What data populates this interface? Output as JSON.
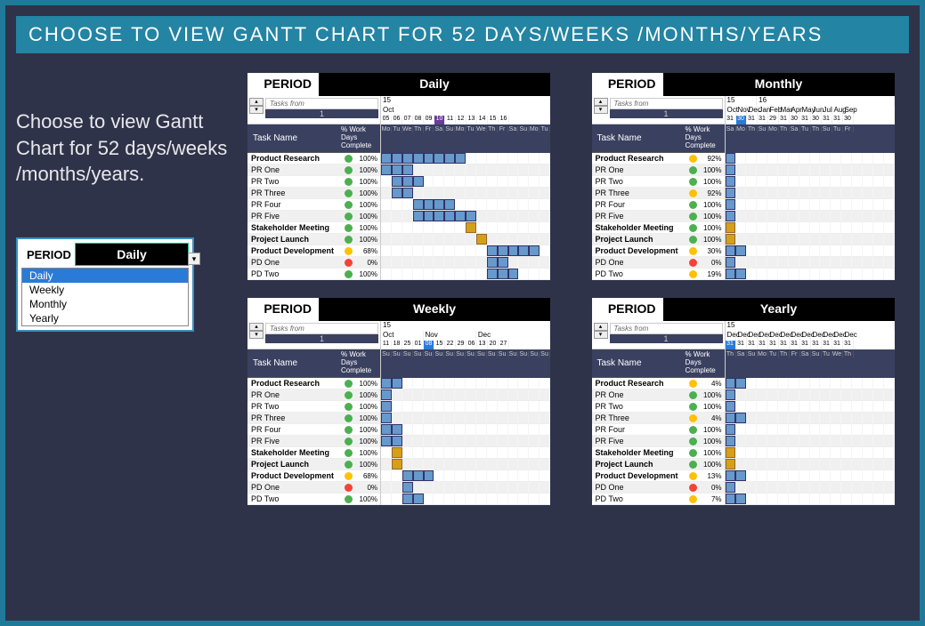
{
  "title": "CHOOSE TO VIEW GANTT CHART FOR 52 DAYS/WEEKS /MONTHS/YEARS",
  "description": "Choose to view Gantt Chart for 52 days/weeks /months/years.",
  "dropdown": {
    "period_label": "PERIOD",
    "selected": "Daily",
    "options": [
      "Daily",
      "Weekly",
      "Monthly",
      "Yearly"
    ]
  },
  "common": {
    "period_label": "PERIOD",
    "tasks_from_label": "Tasks from",
    "tasks_from_value": "1",
    "task_name_header": "Task Name",
    "work_days_header": "% Work Days Complete"
  },
  "tasks_daily": [
    {
      "name": "Product Research",
      "bold": true,
      "status": "green",
      "pct": "100%",
      "bar": [
        0,
        8
      ]
    },
    {
      "name": "PR One",
      "bold": false,
      "status": "green",
      "pct": "100%",
      "bar": [
        0,
        3
      ]
    },
    {
      "name": "PR Two",
      "bold": false,
      "status": "green",
      "pct": "100%",
      "bar": [
        1,
        4
      ]
    },
    {
      "name": "PR Three",
      "bold": false,
      "status": "green",
      "pct": "100%",
      "bar": [
        1,
        3
      ]
    },
    {
      "name": "PR Four",
      "bold": false,
      "status": "green",
      "pct": "100%",
      "bar": [
        3,
        7
      ]
    },
    {
      "name": "PR Five",
      "bold": false,
      "status": "green",
      "pct": "100%",
      "bar": [
        3,
        9
      ]
    },
    {
      "name": "Stakeholder Meeting",
      "bold": true,
      "status": "green",
      "pct": "100%",
      "obar": [
        8,
        9
      ]
    },
    {
      "name": "Project Launch",
      "bold": true,
      "status": "green",
      "pct": "100%",
      "obar": [
        9,
        10
      ]
    },
    {
      "name": "Product Development",
      "bold": true,
      "status": "yellow",
      "pct": "68%",
      "bar": [
        10,
        15
      ]
    },
    {
      "name": "PD One",
      "bold": false,
      "status": "red",
      "pct": "0%",
      "bar": [
        10,
        12
      ]
    },
    {
      "name": "PD Two",
      "bold": false,
      "status": "green",
      "pct": "100%",
      "bar": [
        10,
        13
      ]
    }
  ],
  "tasks_monthly": [
    {
      "name": "Product Research",
      "bold": true,
      "status": "yellow",
      "pct": "92%",
      "bar": [
        0,
        1
      ]
    },
    {
      "name": "PR One",
      "bold": false,
      "status": "green",
      "pct": "100%",
      "bar": [
        0,
        1
      ]
    },
    {
      "name": "PR Two",
      "bold": false,
      "status": "green",
      "pct": "100%",
      "bar": [
        0,
        1
      ]
    },
    {
      "name": "PR Three",
      "bold": false,
      "status": "yellow",
      "pct": "92%",
      "bar": [
        0,
        1
      ]
    },
    {
      "name": "PR Four",
      "bold": false,
      "status": "green",
      "pct": "100%",
      "bar": [
        0,
        1
      ]
    },
    {
      "name": "PR Five",
      "bold": false,
      "status": "green",
      "pct": "100%",
      "bar": [
        0,
        1
      ]
    },
    {
      "name": "Stakeholder Meeting",
      "bold": true,
      "status": "green",
      "pct": "100%",
      "obar": [
        0,
        1
      ]
    },
    {
      "name": "Project Launch",
      "bold": true,
      "status": "green",
      "pct": "100%",
      "obar": [
        0,
        1
      ]
    },
    {
      "name": "Product Development",
      "bold": true,
      "status": "yellow",
      "pct": "30%",
      "bar": [
        0,
        2
      ]
    },
    {
      "name": "PD One",
      "bold": false,
      "status": "red",
      "pct": "0%",
      "bar": [
        0,
        1
      ]
    },
    {
      "name": "PD Two",
      "bold": false,
      "status": "yellow",
      "pct": "19%",
      "bar": [
        0,
        2
      ]
    }
  ],
  "tasks_weekly": [
    {
      "name": "Product Research",
      "bold": true,
      "status": "green",
      "pct": "100%",
      "bar": [
        0,
        2
      ]
    },
    {
      "name": "PR One",
      "bold": false,
      "status": "green",
      "pct": "100%",
      "bar": [
        0,
        1
      ]
    },
    {
      "name": "PR Two",
      "bold": false,
      "status": "green",
      "pct": "100%",
      "bar": [
        0,
        1
      ]
    },
    {
      "name": "PR Three",
      "bold": false,
      "status": "green",
      "pct": "100%",
      "bar": [
        0,
        1
      ]
    },
    {
      "name": "PR Four",
      "bold": false,
      "status": "green",
      "pct": "100%",
      "bar": [
        0,
        2
      ]
    },
    {
      "name": "PR Five",
      "bold": false,
      "status": "green",
      "pct": "100%",
      "bar": [
        0,
        2
      ]
    },
    {
      "name": "Stakeholder Meeting",
      "bold": true,
      "status": "green",
      "pct": "100%",
      "obar": [
        1,
        2
      ]
    },
    {
      "name": "Project Launch",
      "bold": true,
      "status": "green",
      "pct": "100%",
      "obar": [
        1,
        2
      ]
    },
    {
      "name": "Product Development",
      "bold": true,
      "status": "yellow",
      "pct": "68%",
      "bar": [
        2,
        5
      ]
    },
    {
      "name": "PD One",
      "bold": false,
      "status": "red",
      "pct": "0%",
      "bar": [
        2,
        3
      ]
    },
    {
      "name": "PD Two",
      "bold": false,
      "status": "green",
      "pct": "100%",
      "bar": [
        2,
        4
      ]
    }
  ],
  "tasks_yearly": [
    {
      "name": "Product Research",
      "bold": true,
      "status": "yellow",
      "pct": "4%",
      "bar": [
        0,
        2
      ]
    },
    {
      "name": "PR One",
      "bold": false,
      "status": "green",
      "pct": "100%",
      "bar": [
        0,
        1
      ]
    },
    {
      "name": "PR Two",
      "bold": false,
      "status": "green",
      "pct": "100%",
      "bar": [
        0,
        1
      ]
    },
    {
      "name": "PR Three",
      "bold": false,
      "status": "yellow",
      "pct": "4%",
      "bar": [
        0,
        2
      ]
    },
    {
      "name": "PR Four",
      "bold": false,
      "status": "green",
      "pct": "100%",
      "bar": [
        0,
        1
      ]
    },
    {
      "name": "PR Five",
      "bold": false,
      "status": "green",
      "pct": "100%",
      "bar": [
        0,
        1
      ]
    },
    {
      "name": "Stakeholder Meeting",
      "bold": true,
      "status": "green",
      "pct": "100%",
      "obar": [
        0,
        1
      ]
    },
    {
      "name": "Project Launch",
      "bold": true,
      "status": "green",
      "pct": "100%",
      "obar": [
        0,
        1
      ]
    },
    {
      "name": "Product Development",
      "bold": true,
      "status": "yellow",
      "pct": "13%",
      "bar": [
        0,
        2
      ]
    },
    {
      "name": "PD One",
      "bold": false,
      "status": "red",
      "pct": "0%",
      "bar": [
        0,
        1
      ]
    },
    {
      "name": "PD Two",
      "bold": false,
      "status": "yellow",
      "pct": "7%",
      "bar": [
        0,
        2
      ]
    }
  ],
  "panels": [
    {
      "id": "daily",
      "value": "Daily",
      "tasks_key": "tasks_daily",
      "year_row": [
        {
          "label": "15",
          "span": 16
        }
      ],
      "month_row": [
        {
          "label": "Oct",
          "span": 16
        }
      ],
      "date_row": [
        "Mo",
        "Tu",
        "We",
        "Th",
        "Fr",
        "Sa",
        "Su",
        "Mo",
        "Tu",
        "We",
        "Th",
        "Fr",
        "Sa",
        "Su",
        "Mo",
        "Tu"
      ],
      "num_row": [
        "05",
        "06",
        "07",
        "08",
        "09",
        "10",
        "11",
        "12",
        "13",
        "14",
        "15",
        "16"
      ],
      "hl_idx": 5,
      "hl_style": "hl"
    },
    {
      "id": "monthly",
      "value": "Monthly",
      "tasks_key": "tasks_monthly",
      "year_row": [
        {
          "label": "15",
          "span": 3
        },
        {
          "label": "16",
          "span": 13
        }
      ],
      "month_row": [
        {
          "label": "Oct",
          "span": 1
        },
        {
          "label": "Nov",
          "span": 1
        },
        {
          "label": "Dec",
          "span": 1
        },
        {
          "label": "Jan",
          "span": 1
        },
        {
          "label": "Feb",
          "span": 1
        },
        {
          "label": "Mar",
          "span": 1
        },
        {
          "label": "Apr",
          "span": 1
        },
        {
          "label": "May",
          "span": 1
        },
        {
          "label": "Jun",
          "span": 1
        },
        {
          "label": "Jul",
          "span": 1
        },
        {
          "label": "Aug",
          "span": 1
        },
        {
          "label": "Sep",
          "span": 1
        }
      ],
      "date_row": [
        "Sa",
        "Mo",
        "Th",
        "Su",
        "Mo",
        "Th",
        "Sa",
        "Tu",
        "Th",
        "Su",
        "Tu",
        "Fr"
      ],
      "num_row": [
        "31",
        "30",
        "31",
        "31",
        "29",
        "31",
        "30",
        "31",
        "30",
        "31",
        "31",
        "30"
      ],
      "hl_idx": 1,
      "hl_style": "hl2"
    },
    {
      "id": "weekly",
      "value": "Weekly",
      "tasks_key": "tasks_weekly",
      "year_row": [
        {
          "label": "15",
          "span": 16
        }
      ],
      "month_row": [
        {
          "label": "Oct",
          "span": 4
        },
        {
          "label": "Nov",
          "span": 5
        },
        {
          "label": "Dec",
          "span": 7
        }
      ],
      "date_row": [
        "Su",
        "Su",
        "Su",
        "Su",
        "Su",
        "Su",
        "Su",
        "Su",
        "Su",
        "Su",
        "Su",
        "Su",
        "Su",
        "Su",
        "Su",
        "Su"
      ],
      "num_row": [
        "11",
        "18",
        "25",
        "01",
        "08",
        "15",
        "22",
        "29",
        "06",
        "13",
        "20",
        "27"
      ],
      "hl_idx": 4,
      "hl_style": "hl2"
    },
    {
      "id": "yearly",
      "value": "Yearly",
      "tasks_key": "tasks_yearly",
      "year_row": [
        {
          "label": "15",
          "span": 16
        }
      ],
      "month_row": [
        {
          "label": "Dec",
          "span": 1
        },
        {
          "label": "Dec",
          "span": 1
        },
        {
          "label": "Dec",
          "span": 1
        },
        {
          "label": "Dec",
          "span": 1
        },
        {
          "label": "Dec",
          "span": 1
        },
        {
          "label": "Dec",
          "span": 1
        },
        {
          "label": "Dec",
          "span": 1
        },
        {
          "label": "Dec",
          "span": 1
        },
        {
          "label": "Dec",
          "span": 1
        },
        {
          "label": "Dec",
          "span": 1
        },
        {
          "label": "Dec",
          "span": 1
        },
        {
          "label": "Dec",
          "span": 1
        }
      ],
      "date_row": [
        "Th",
        "Sa",
        "Su",
        "Mo",
        "Tu",
        "Th",
        "Fr",
        "Sa",
        "Su",
        "Tu",
        "We",
        "Th"
      ],
      "num_row": [
        "31",
        "31",
        "31",
        "31",
        "31",
        "31",
        "31",
        "31",
        "31",
        "31",
        "31",
        "31"
      ],
      "hl_idx": 0,
      "hl_style": "hl2"
    }
  ]
}
